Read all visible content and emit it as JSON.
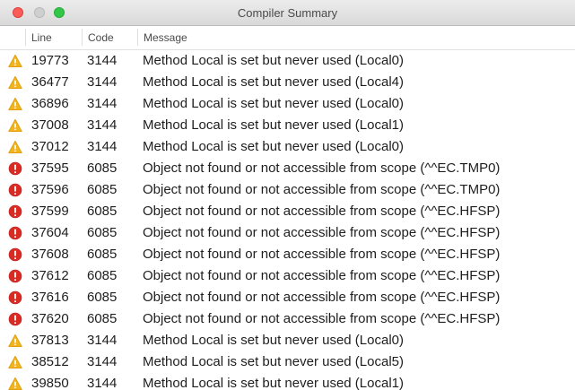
{
  "window": {
    "title": "Compiler Summary"
  },
  "columns": {
    "line": "Line",
    "code": "Code",
    "message": "Message"
  },
  "icons": {
    "warning": "warning-icon",
    "error": "error-icon"
  },
  "colors": {
    "warning": "#f2b41d",
    "error": "#d92a24"
  },
  "rows": [
    {
      "severity": "warning",
      "line": "19773",
      "code": "3144",
      "message": "Method Local is set but never used (Local0)"
    },
    {
      "severity": "warning",
      "line": "36477",
      "code": "3144",
      "message": "Method Local is set but never used (Local4)"
    },
    {
      "severity": "warning",
      "line": "36896",
      "code": "3144",
      "message": "Method Local is set but never used (Local0)"
    },
    {
      "severity": "warning",
      "line": "37008",
      "code": "3144",
      "message": "Method Local is set but never used (Local1)"
    },
    {
      "severity": "warning",
      "line": "37012",
      "code": "3144",
      "message": "Method Local is set but never used (Local0)"
    },
    {
      "severity": "error",
      "line": "37595",
      "code": "6085",
      "message": "Object not found or not accessible from scope (^^EC.TMP0)"
    },
    {
      "severity": "error",
      "line": "37596",
      "code": "6085",
      "message": "Object not found or not accessible from scope (^^EC.TMP0)"
    },
    {
      "severity": "error",
      "line": "37599",
      "code": "6085",
      "message": "Object not found or not accessible from scope (^^EC.HFSP)"
    },
    {
      "severity": "error",
      "line": "37604",
      "code": "6085",
      "message": "Object not found or not accessible from scope (^^EC.HFSP)"
    },
    {
      "severity": "error",
      "line": "37608",
      "code": "6085",
      "message": "Object not found or not accessible from scope (^^EC.HFSP)"
    },
    {
      "severity": "error",
      "line": "37612",
      "code": "6085",
      "message": "Object not found or not accessible from scope (^^EC.HFSP)"
    },
    {
      "severity": "error",
      "line": "37616",
      "code": "6085",
      "message": "Object not found or not accessible from scope (^^EC.HFSP)"
    },
    {
      "severity": "error",
      "line": "37620",
      "code": "6085",
      "message": "Object not found or not accessible from scope (^^EC.HFSP)"
    },
    {
      "severity": "warning",
      "line": "37813",
      "code": "3144",
      "message": "Method Local is set but never used (Local0)"
    },
    {
      "severity": "warning",
      "line": "38512",
      "code": "3144",
      "message": "Method Local is set but never used (Local5)"
    },
    {
      "severity": "warning",
      "line": "39850",
      "code": "3144",
      "message": "Method Local is set but never used (Local1)"
    }
  ]
}
